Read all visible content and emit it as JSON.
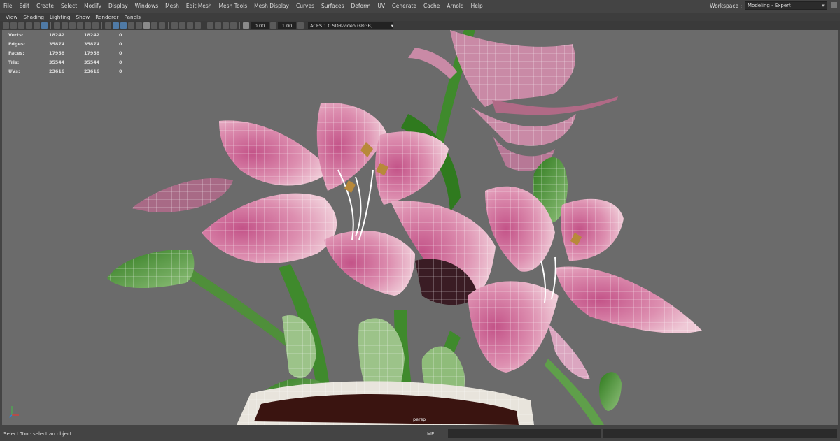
{
  "menu": [
    "File",
    "Edit",
    "Create",
    "Select",
    "Modify",
    "Display",
    "Windows",
    "Mesh",
    "Edit Mesh",
    "Mesh Tools",
    "Mesh Display",
    "Curves",
    "Surfaces",
    "Deform",
    "UV",
    "Generate",
    "Cache",
    "Arnold",
    "Help"
  ],
  "workspace": {
    "label": "Workspace :",
    "value": "Modeling - Expert"
  },
  "panel_menu": [
    "View",
    "Shading",
    "Lighting",
    "Show",
    "Renderer",
    "Panels"
  ],
  "toolbar": {
    "exposure": "0.00",
    "gamma": "1.00",
    "colorspace": "ACES 1.0 SDR-video (sRGB)"
  },
  "hud": [
    {
      "label": "Verts:",
      "a": "18242",
      "b": "18242",
      "c": "0"
    },
    {
      "label": "Edges:",
      "a": "35874",
      "b": "35874",
      "c": "0"
    },
    {
      "label": "Faces:",
      "a": "17958",
      "b": "17958",
      "c": "0"
    },
    {
      "label": "Tris:",
      "a": "35544",
      "b": "35544",
      "c": "0"
    },
    {
      "label": "UVs:",
      "a": "23616",
      "b": "23616",
      "c": "0"
    }
  ],
  "camera_label": "persp",
  "status": {
    "help": "Select Tool: select an object",
    "mel": "MEL"
  },
  "colors": {
    "petal": "#d987aa",
    "petal_dark": "#b8587f",
    "leaf": "#4f8f3a",
    "stem": "#3f8a2c",
    "viewport_bg": "#6b6b6b",
    "pot": "#e8e4dc"
  }
}
